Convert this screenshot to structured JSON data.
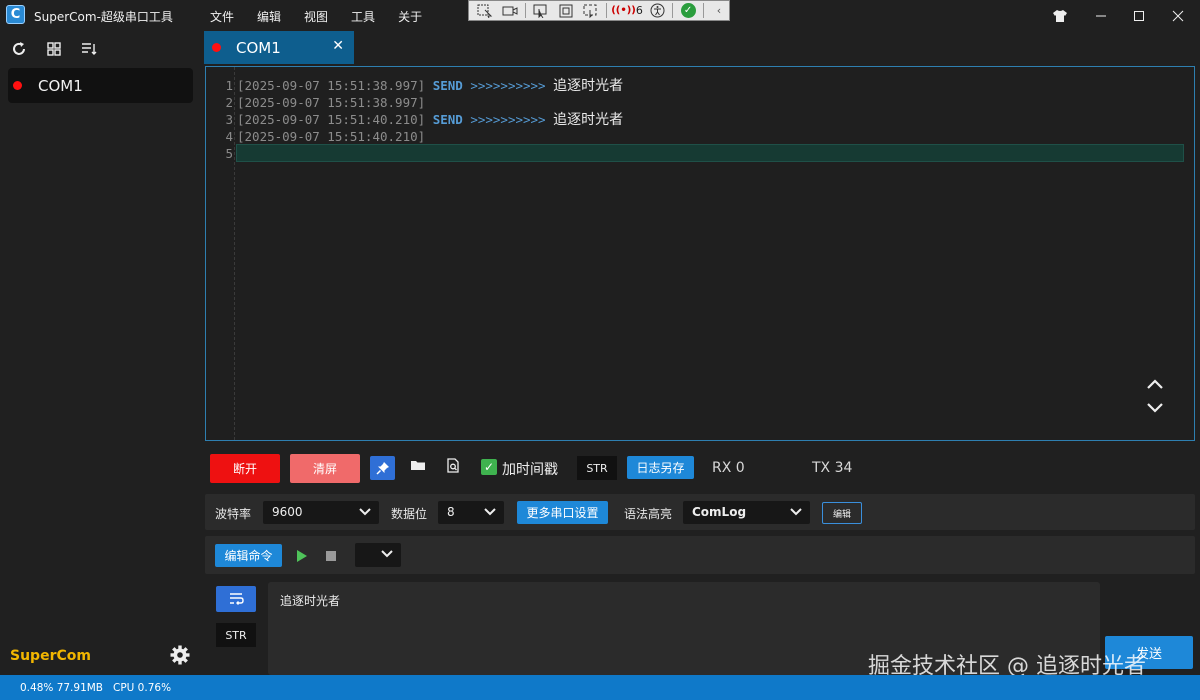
{
  "app": {
    "title": "SuperCom-超级串口工具",
    "logo_letter": "C",
    "brand": "SuperCom"
  },
  "menu": [
    "文件",
    "编辑",
    "视图",
    "工具",
    "关于"
  ],
  "devtools": {
    "badge_count": "6"
  },
  "sidebar": {
    "ports": [
      {
        "label": "COM1",
        "status_color": "#ff1010"
      }
    ]
  },
  "tab": {
    "label": "COM1",
    "close": "✕"
  },
  "editor": {
    "lines": [
      {
        "num": "1",
        "ts": "[2025-09-07 15:51:38.997]",
        "kw": "SEND",
        "arrows": ">>>>>>>>>>",
        "msg": "追逐时光者"
      },
      {
        "num": "2",
        "ts": "[2025-09-07 15:51:38.997]",
        "kw": "",
        "arrows": "",
        "msg": ""
      },
      {
        "num": "3",
        "ts": "[2025-09-07 15:51:40.210]",
        "kw": "SEND",
        "arrows": ">>>>>>>>>>",
        "msg": "追逐时光者"
      },
      {
        "num": "4",
        "ts": "[2025-09-07 15:51:40.210]",
        "kw": "",
        "arrows": "",
        "msg": ""
      },
      {
        "num": "5",
        "ts": "",
        "kw": "",
        "arrows": "",
        "msg": ""
      }
    ]
  },
  "controls": {
    "disconnect": "断开",
    "clear": "清屏",
    "timestamp_label": "加时间戳",
    "timestamp_checked": true,
    "format": "STR",
    "save_log": "日志另存",
    "rx": "RX 0",
    "tx": "TX 34"
  },
  "settings": {
    "baud_label": "波特率",
    "baud_value": "9600",
    "databits_label": "数据位",
    "databits_value": "8",
    "more_settings": "更多串口设置",
    "syntax_label": "语法高亮",
    "syntax_value": "ComLog",
    "edit": "编辑"
  },
  "commands": {
    "edit_commands": "编辑命令"
  },
  "send": {
    "format": "STR",
    "text": "追逐时光者",
    "button": "发送"
  },
  "watermark": "掘金技术社区 @ 追逐时光者",
  "status": {
    "mem": "0.48% 77.91MB",
    "cpu": "CPU 0.76%"
  },
  "colors": {
    "accent": "#1e88d8",
    "status_bar": "#0f79c9",
    "disconnect": "#ee1111",
    "clear": "#f06a6a",
    "brand": "#f2b600"
  }
}
